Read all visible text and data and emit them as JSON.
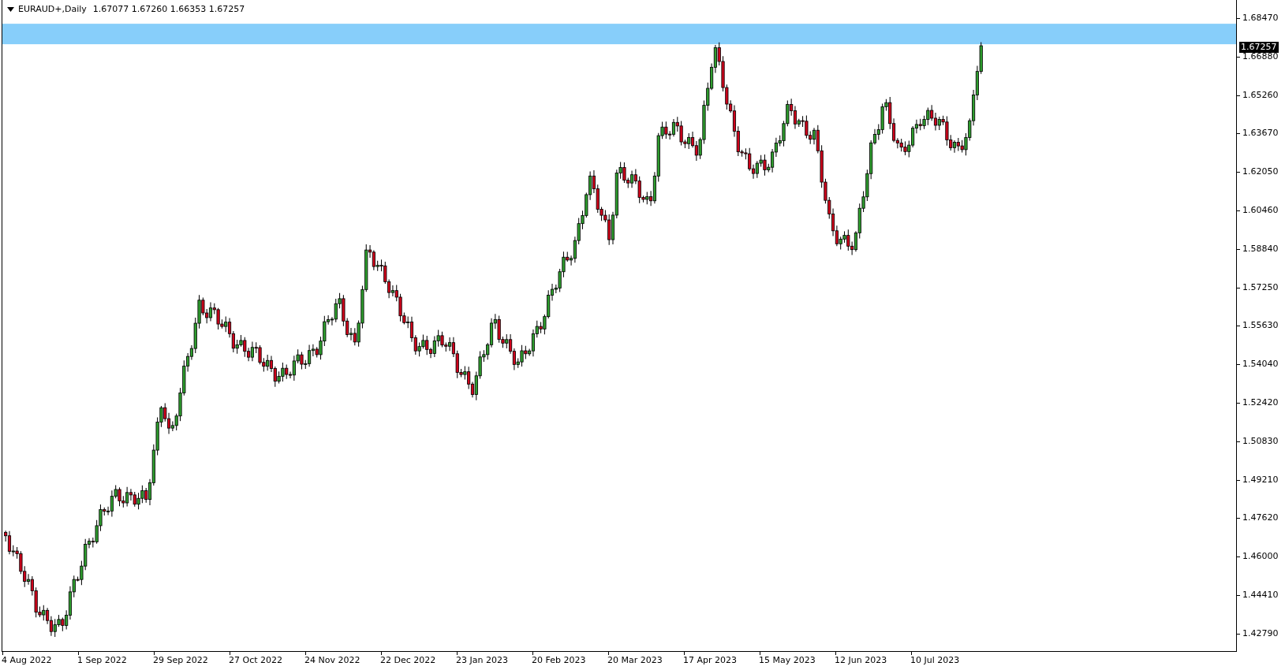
{
  "chart_header": {
    "symbol": "EURAUD+,Daily",
    "ohlc": "1.67077 1.67260 1.66353 1.67257"
  },
  "price_axis": {
    "labels": [
      "1.68470",
      "1.66880",
      "1.65260",
      "1.63670",
      "1.62050",
      "1.60460",
      "1.58840",
      "1.57250",
      "1.55630",
      "1.54040",
      "1.52420",
      "1.50830",
      "1.49210",
      "1.47620",
      "1.46000",
      "1.44410",
      "1.42790"
    ],
    "current_price": "1.67257"
  },
  "time_axis": {
    "labels": [
      "4 Aug 2022",
      "1 Sep 2022",
      "29 Sep 2022",
      "27 Oct 2022",
      "24 Nov 2022",
      "22 Dec 2022",
      "23 Jan 2023",
      "20 Feb 2023",
      "20 Mar 2023",
      "17 Apr 2023",
      "15 May 2023",
      "12 Jun 2023",
      "10 Jul 2023"
    ]
  }
}
